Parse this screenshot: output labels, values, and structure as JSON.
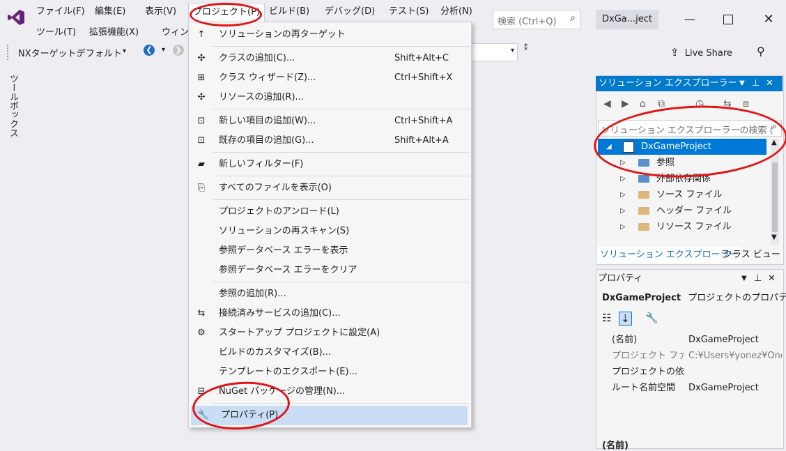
{
  "menubar": {
    "row1": [
      "ファイル(F)",
      "編集(E)",
      "表示(V)",
      "プロジェクト(P)",
      "ビルド(B)",
      "デバッグ(D)",
      "テスト(S)",
      "分析(N)"
    ],
    "row2": [
      "ツール(T)",
      "拡張機能(X)",
      "ウィンド"
    ],
    "search_placeholder": "検索 (Ctrl+Q)",
    "solution_name": "DxGa...ject"
  },
  "toolbar": {
    "nx_target": "NXターゲット:",
    "nx_value": "デフォルト",
    "live_share": "Live Share"
  },
  "left_tab": "ツールボックス",
  "dropdown": {
    "items": [
      {
        "icon": "↑",
        "label": "ソリューションの再ターゲット",
        "shortcut": ""
      },
      {
        "icon": "✣",
        "label": "クラスの追加(C)...",
        "shortcut": "Shift+Alt+C"
      },
      {
        "icon": "⊞",
        "label": "クラス ウィザード(Z)...",
        "shortcut": "Ctrl+Shift+X"
      },
      {
        "icon": "✣",
        "label": "リソースの追加(R)...",
        "shortcut": ""
      },
      {
        "icon": "⊡",
        "label": "新しい項目の追加(W)...",
        "shortcut": "Ctrl+Shift+A"
      },
      {
        "icon": "⊡",
        "label": "既存の項目の追加(G)...",
        "shortcut": "Shift+Alt+A"
      },
      {
        "icon": "▰",
        "label": "新しいフィルター(F)",
        "shortcut": ""
      },
      {
        "icon": "⎘",
        "label": "すべてのファイルを表示(O)",
        "shortcut": ""
      },
      {
        "icon": "",
        "label": "プロジェクトのアンロード(L)",
        "shortcut": ""
      },
      {
        "icon": "",
        "label": "ソリューションの再スキャン(S)",
        "shortcut": ""
      },
      {
        "icon": "",
        "label": "参照データベース エラーを表示",
        "shortcut": ""
      },
      {
        "icon": "",
        "label": "参照データベース エラーをクリア",
        "shortcut": ""
      },
      {
        "icon": "",
        "label": "参照の追加(R)...",
        "shortcut": ""
      },
      {
        "icon": "⇆",
        "label": "接続済みサービスの追加(C)...",
        "shortcut": ""
      },
      {
        "icon": "⚙",
        "label": "スタートアップ プロジェクトに設定(A)",
        "shortcut": ""
      },
      {
        "icon": "",
        "label": "ビルドのカスタマイズ(B)...",
        "shortcut": ""
      },
      {
        "icon": "",
        "label": "テンプレートのエクスポート(E)...",
        "shortcut": ""
      },
      {
        "icon": "⊟",
        "label": "NuGet パッケージの管理(N)...",
        "shortcut": ""
      },
      {
        "icon": "🔧",
        "label": "プロパティ(P)",
        "shortcut": ""
      }
    ]
  },
  "solution_explorer": {
    "title": "ソリューション エクスプローラー",
    "search_placeholder": "ソリューション エクスプローラーの検索 (",
    "project": "DxGameProject",
    "nodes": [
      "参照",
      "外部依存関係",
      "ソース ファイル",
      "ヘッダー ファイル",
      "リソース ファイル"
    ],
    "tabs": [
      "ソリューション エクスプローラー",
      "クラス ビュー"
    ]
  },
  "properties": {
    "title": "プロパティ",
    "object_name": "DxGameProject",
    "object_type": "プロジェクトのプロパテ",
    "rows": [
      {
        "name": "(名前)",
        "value": "DxGameProject"
      },
      {
        "name": "プロジェクト ファイル",
        "value": "C:¥Users¥yonez¥One"
      },
      {
        "name": "プロジェクトの依存",
        "value": ""
      },
      {
        "name": "ルート名前空間",
        "value": "DxGameProject"
      }
    ],
    "footer": "(名前)"
  },
  "colors": {
    "accent": "#007acc",
    "highlight": "#c9def5",
    "annotation": "#e21313",
    "vs_logo": "#68217a"
  }
}
